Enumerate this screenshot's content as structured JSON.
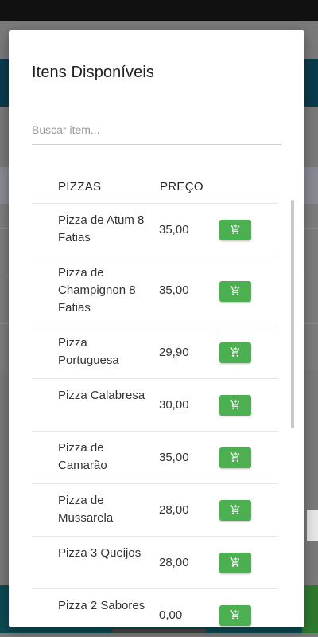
{
  "modal": {
    "title": "Itens Disponíveis",
    "search": {
      "placeholder": "Buscar item...",
      "value": ""
    },
    "table": {
      "headers": {
        "name": "PIZZAS",
        "price": "PREÇO"
      },
      "rows": [
        {
          "name": "Pizza de Atum 8 Fatias",
          "price": "35,00"
        },
        {
          "name": "Pizza de Champignon 8 Fatias",
          "price": "35,00"
        },
        {
          "name": "Pizza Portuguesa",
          "price": "29,90"
        },
        {
          "name": "Pizza Calabresa",
          "price": "30,00"
        },
        {
          "name": "Pizza de Camarão",
          "price": "35,00"
        },
        {
          "name": "Pizza de Mussarela",
          "price": "28,00"
        },
        {
          "name": "Pizza 3 Queijos",
          "price": "28,00"
        },
        {
          "name": "Pizza 2 Sabores",
          "price": "0,00"
        }
      ]
    }
  },
  "colors": {
    "accent_green": "#4caf50",
    "header_dark": "#0b3a4d"
  },
  "icons": {
    "row_action": "add-shopping-cart-icon"
  }
}
